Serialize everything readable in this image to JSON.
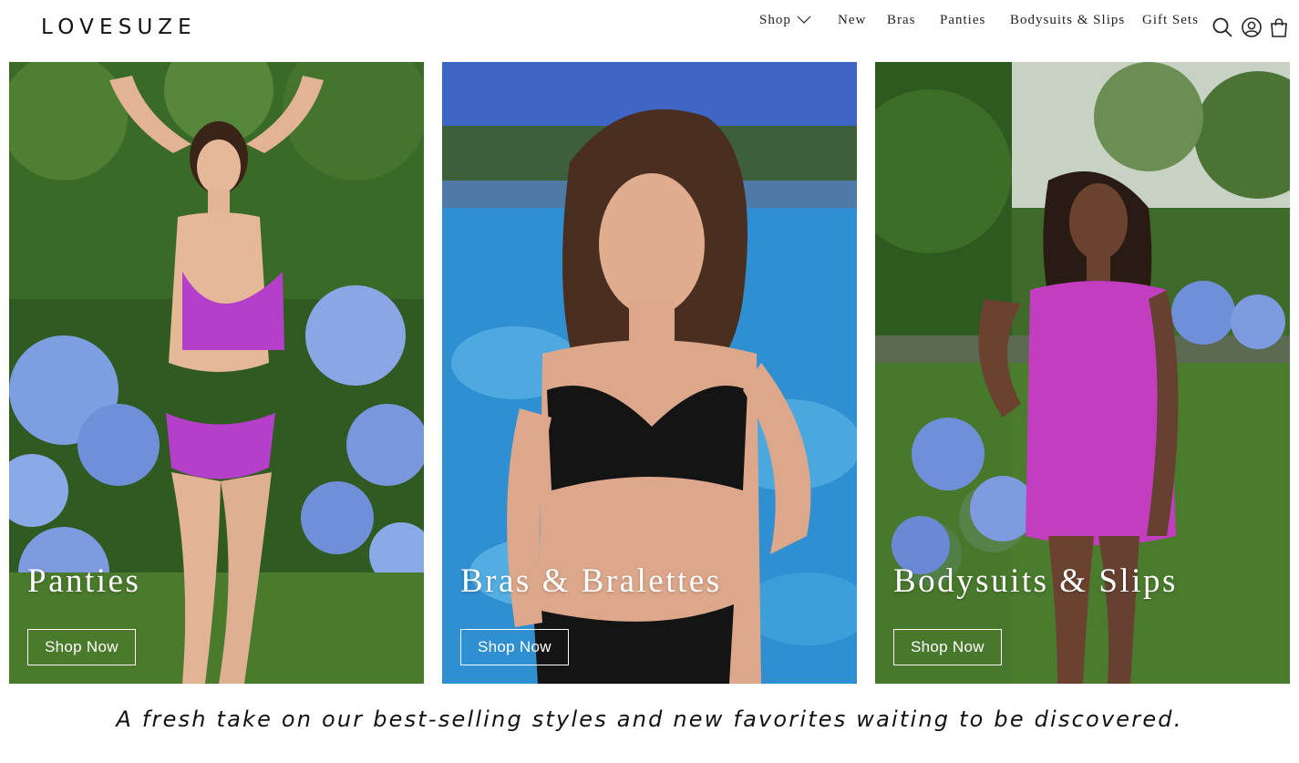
{
  "header": {
    "logo": "LOVESUZE",
    "nav": [
      {
        "label": "Shop"
      },
      {
        "label": "New"
      },
      {
        "label": "Bras"
      },
      {
        "label": "Panties"
      },
      {
        "label": "Bodysuits & Slips"
      },
      {
        "label": "Gift Sets"
      }
    ],
    "icons": [
      "search-icon",
      "account-icon",
      "shopping-bag-icon"
    ]
  },
  "panels": [
    {
      "title": "Panties",
      "button": "Shop Now"
    },
    {
      "title": "Bras & Bralettes",
      "button": "Shop Now"
    },
    {
      "title": "Bodysuits & Slips",
      "button": "Shop Now"
    }
  ],
  "tagline": "A fresh take on our best-selling styles and new favorites waiting to be discovered.",
  "colors": {
    "accent_magenta": "#b43fc8",
    "foliage_green": "#3f6b2a",
    "hydrangea_blue": "#6f8fd8",
    "pool_blue": "#2f8fd0"
  }
}
